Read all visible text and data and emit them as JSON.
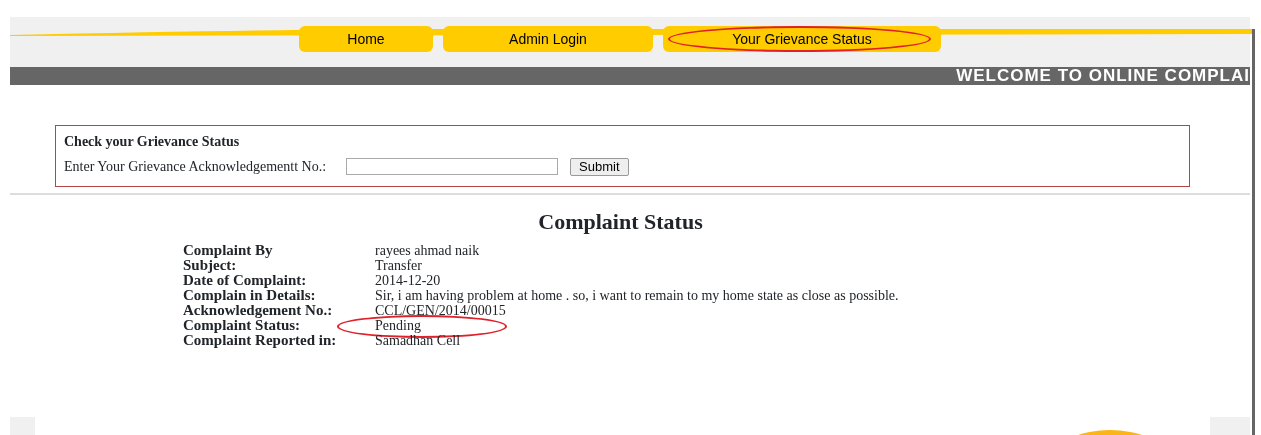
{
  "nav": [
    {
      "label": "Home",
      "circled": false
    },
    {
      "label": "Admin Login",
      "circled": false
    },
    {
      "label": "Your Grievance Status",
      "circled": true
    }
  ],
  "banner": "WELCOME TO ONLINE COMPLAI",
  "form": {
    "title": "Check your Grievance Status",
    "label": "Enter Your Grievance Acknowledgementt No.:",
    "button": "Submit"
  },
  "heading": "Complaint Status",
  "details": [
    {
      "label": "Complaint By",
      "value": "rayees ahmad naik",
      "circled": false
    },
    {
      "label": "Subject:",
      "value": "Transfer",
      "circled": false
    },
    {
      "label": "Date of Complaint:",
      "value": "2014-12-20",
      "circled": false
    },
    {
      "label": "Complain in Details:",
      "value": "Sir, i am having problem at home . so, i want to remain to my home state as close as possible.",
      "circled": false
    },
    {
      "label": "Acknowledgement No.:",
      "value": "CCL/GEN/2014/00015",
      "circled": false
    },
    {
      "label": "Complaint Status:",
      "value": "Pending",
      "circled": true
    },
    {
      "label": "Complaint Reported in:",
      "value": "Samadhan Cell",
      "circled": false
    }
  ]
}
